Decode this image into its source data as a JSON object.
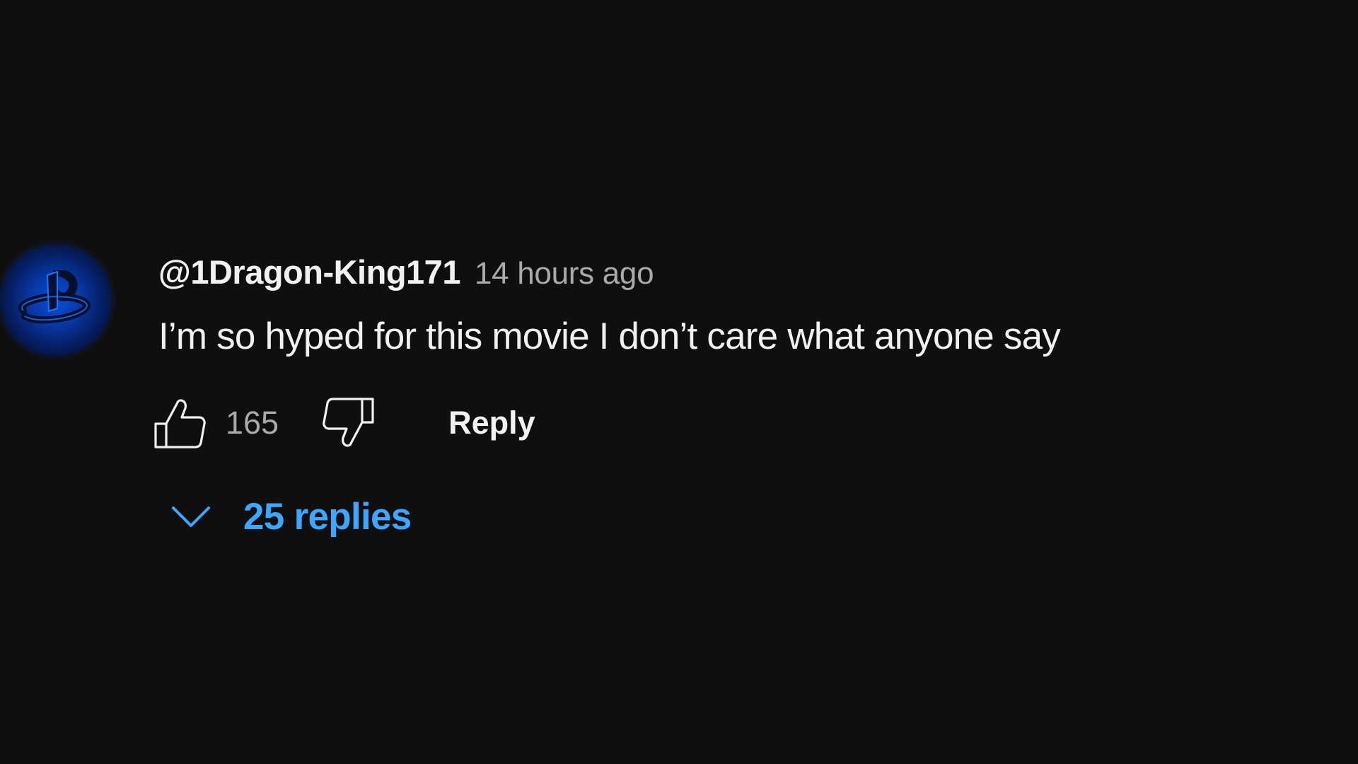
{
  "comment": {
    "author": "@1Dragon-King171",
    "timestamp": "14 hours ago",
    "text": "I’m so hyped for this movie I don’t care what anyone say",
    "like_count": "165",
    "reply_label": "Reply",
    "replies_label": "25 replies",
    "avatar_icon": "playstation-logo-icon"
  },
  "icons": {
    "like": "thumb-up-icon",
    "dislike": "thumb-down-icon",
    "expand_replies": "chevron-down-icon"
  },
  "colors": {
    "background": "#0f0f0f",
    "primary_text": "#f1f1f1",
    "secondary_text": "#aaaaaa",
    "link_blue": "#3ea6ff",
    "avatar_blue": "#0a4fd8"
  }
}
